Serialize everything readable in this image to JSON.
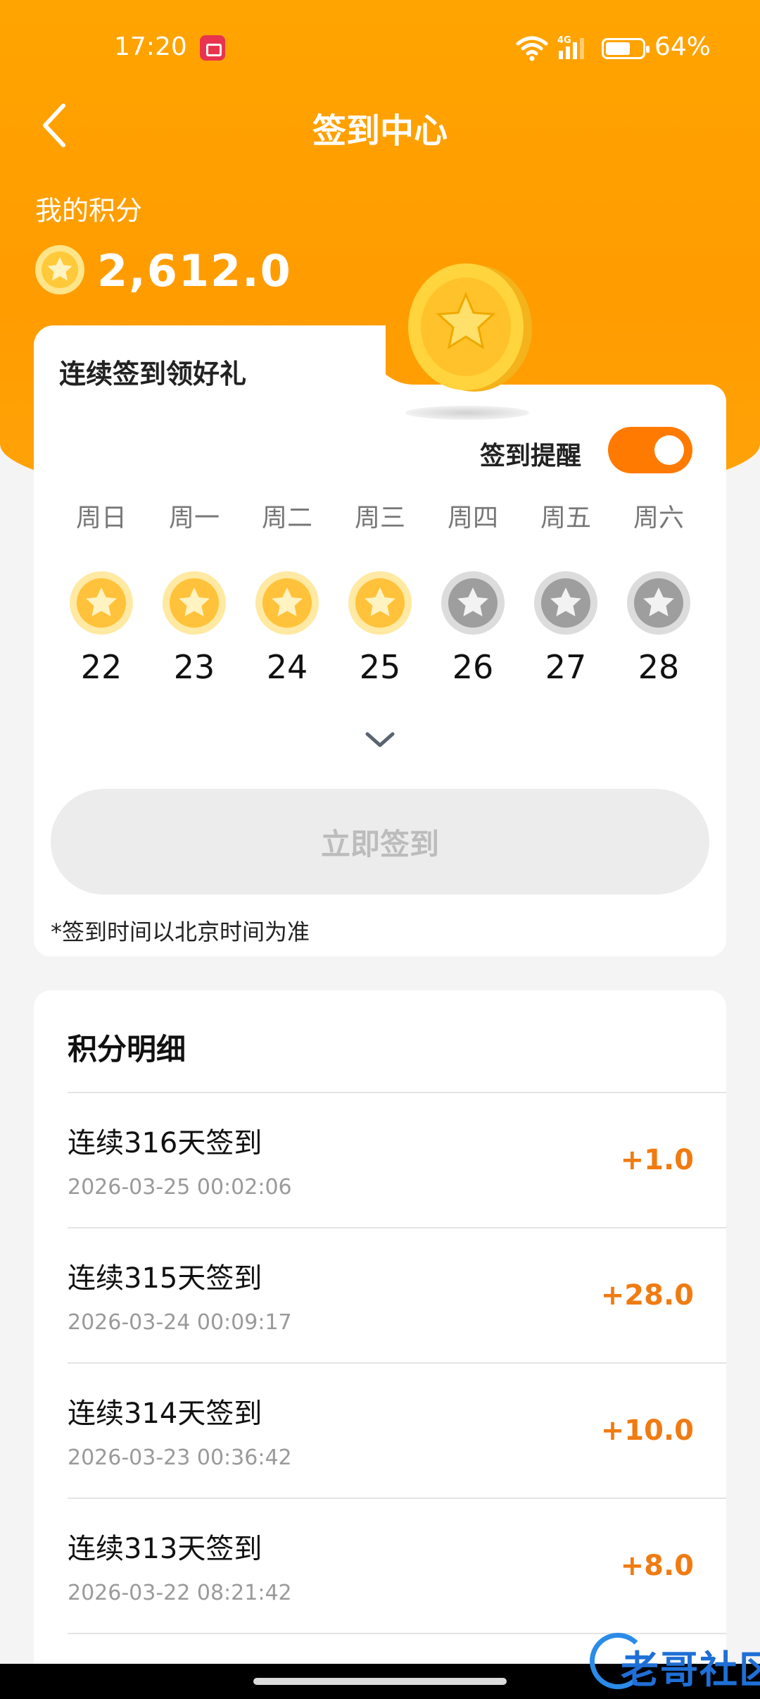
{
  "status_bar": {
    "time": "17:20",
    "battery": "64%",
    "signal_label": "4G"
  },
  "header": {
    "title": "签到中心"
  },
  "points": {
    "label": "我的积分",
    "value": "2,612.0"
  },
  "checkin": {
    "title": "连续签到领好礼",
    "reminder_label": "签到提醒",
    "reminder_on": true,
    "week": [
      {
        "day": "周日",
        "date": "22",
        "checked": true
      },
      {
        "day": "周一",
        "date": "23",
        "checked": true
      },
      {
        "day": "周二",
        "date": "24",
        "checked": true
      },
      {
        "day": "周三",
        "date": "25",
        "checked": true
      },
      {
        "day": "周四",
        "date": "26",
        "checked": false
      },
      {
        "day": "周五",
        "date": "27",
        "checked": false
      },
      {
        "day": "周六",
        "date": "28",
        "checked": false
      }
    ],
    "button_label": "立即签到",
    "note": "*签到时间以北京时间为准"
  },
  "details": {
    "title": "积分明细",
    "items": [
      {
        "name": "连续316天签到",
        "time": "2026-03-25 00:02:06",
        "points": "+1.0"
      },
      {
        "name": "连续315天签到",
        "time": "2026-03-24 00:09:17",
        "points": "+28.0"
      },
      {
        "name": "连续314天签到",
        "time": "2026-03-23 00:36:42",
        "points": "+10.0"
      },
      {
        "name": "连续313天签到",
        "time": "2026-03-22 08:21:42",
        "points": "+8.0"
      }
    ]
  },
  "watermark": {
    "text": "老哥社区"
  },
  "colors": {
    "accent": "#ff9c00",
    "points_positive": "#f07b12",
    "toggle_on": "#ff7a00"
  }
}
